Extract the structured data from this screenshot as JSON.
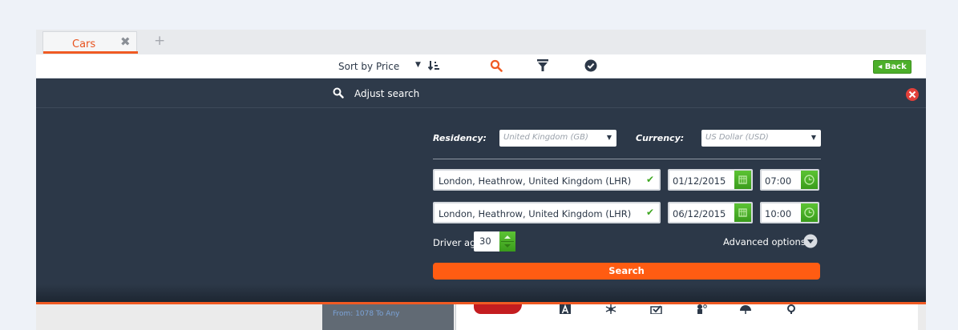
{
  "tabs": [
    {
      "label": "Cars",
      "close_icon": "close-icon"
    }
  ],
  "tab_add_label": "+",
  "toolbar": {
    "sort_label": "Sort by Price",
    "sort_caret": "▼",
    "back_label": "◂ Back",
    "accent_color": "#f05a23",
    "back_color": "#4caf2a"
  },
  "adjust": {
    "label": "Adjust search"
  },
  "form": {
    "residency_label": "Residency:",
    "residency_value": "United Kingdom (GB)",
    "currency_label": "Currency:",
    "currency_value": "US Dollar (USD)",
    "caret": "▼",
    "check": "✔",
    "pickup": {
      "location": "London, Heathrow, United Kingdom (LHR)",
      "date": "01/12/2015",
      "time": "07:00"
    },
    "dropoff": {
      "location": "London, Heathrow, United Kingdom (LHR)",
      "date": "06/12/2015",
      "time": "10:00"
    },
    "driver_age_label": "Driver age",
    "driver_age_value": "30",
    "advanced_label": "Advanced options",
    "search_label": "Search",
    "search_color": "#ff5c12"
  },
  "results": {
    "route_text": "From: 1078 To Any"
  }
}
